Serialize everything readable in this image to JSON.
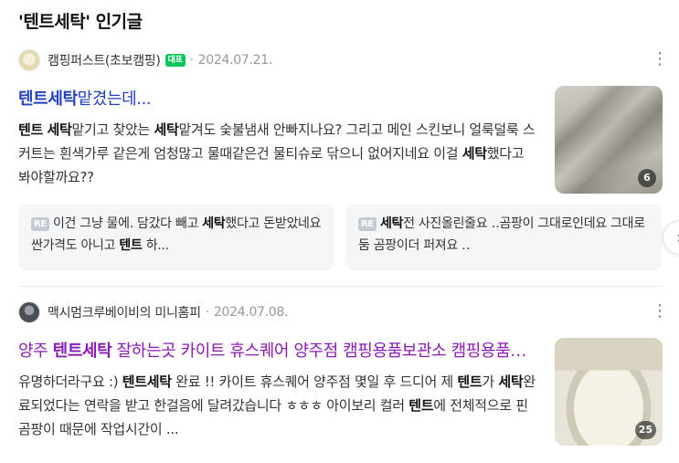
{
  "section": {
    "title": "'텐트세탁' 인기글"
  },
  "posts": [
    {
      "source": "캠핑퍼스트(초보캠핑)",
      "badge": "대표",
      "dot": "·",
      "date": "2024.07.21.",
      "more_icon": "⋮",
      "title_kw": "텐트세탁",
      "title_rest": "맡겼는데...",
      "body": [
        {
          "t": "텐트",
          "b": true
        },
        {
          "t": " ",
          "b": false
        },
        {
          "t": "세탁",
          "b": true
        },
        {
          "t": "맡기고 찾았는 ",
          "b": false
        },
        {
          "t": "세탁",
          "b": true
        },
        {
          "t": "맡겨도 숯불냄새 안빠지나요? 그리고 메인 스킨보니 얼룩덜룩 스커트는 흰색가루 같은게 엄청많고 물때같은건 물티슈로 닦으니 없어지네요 이걸 ",
          "b": false
        },
        {
          "t": "세탁",
          "b": true
        },
        {
          "t": "했다고 봐야할까요??",
          "b": false
        }
      ],
      "thumb_count": "6"
    },
    {
      "source": "맥시멈크루베이비의 미니홈피",
      "dot": "·",
      "date": "2024.07.08.",
      "more_icon": "⋮",
      "title_pre": "양주 ",
      "title_kw": "텐트세탁",
      "title_rest": " 잘하는곳 카이트 휴스퀘어 양주점 캠핑용품보관소 캠핑용품세탁",
      "body": [
        {
          "t": "유명하더라구요 :) ",
          "b": false
        },
        {
          "t": "텐트세탁",
          "b": true
        },
        {
          "t": " 완료 !! 카이트 휴스퀘어 양주점 몇일 후 드디어 제 ",
          "b": false
        },
        {
          "t": "텐트",
          "b": true
        },
        {
          "t": "가 ",
          "b": false
        },
        {
          "t": "세탁",
          "b": true
        },
        {
          "t": "완료되었다는 연락을 받고 한걸음에 달려갔습니다 ㅎㅎㅎ 아이보리 컬러 ",
          "b": false
        },
        {
          "t": "텐트",
          "b": true
        },
        {
          "t": "에 전체적으로 핀 곰팡이 때문에 작업시간이 ...",
          "b": false
        }
      ],
      "thumb_count": "25"
    }
  ],
  "replies": [
    {
      "badge": "RE",
      "parts": [
        {
          "t": "이건 그냥 물에. 담갔다 빼고 ",
          "b": false
        },
        {
          "t": "세탁",
          "b": true
        },
        {
          "t": "했다고 돈받았네요 싼가격도 아니고 ",
          "b": false
        },
        {
          "t": "텐트",
          "b": true
        },
        {
          "t": " 하...",
          "b": false
        }
      ]
    },
    {
      "badge": "RE",
      "parts": [
        {
          "t": "세탁",
          "b": true
        },
        {
          "t": "전 사진올린줄요 ‥곰팡이 그대로인데요 그대로둠 곰팡이더 퍼져요 ‥",
          "b": false
        }
      ]
    }
  ],
  "next_icon": "›"
}
